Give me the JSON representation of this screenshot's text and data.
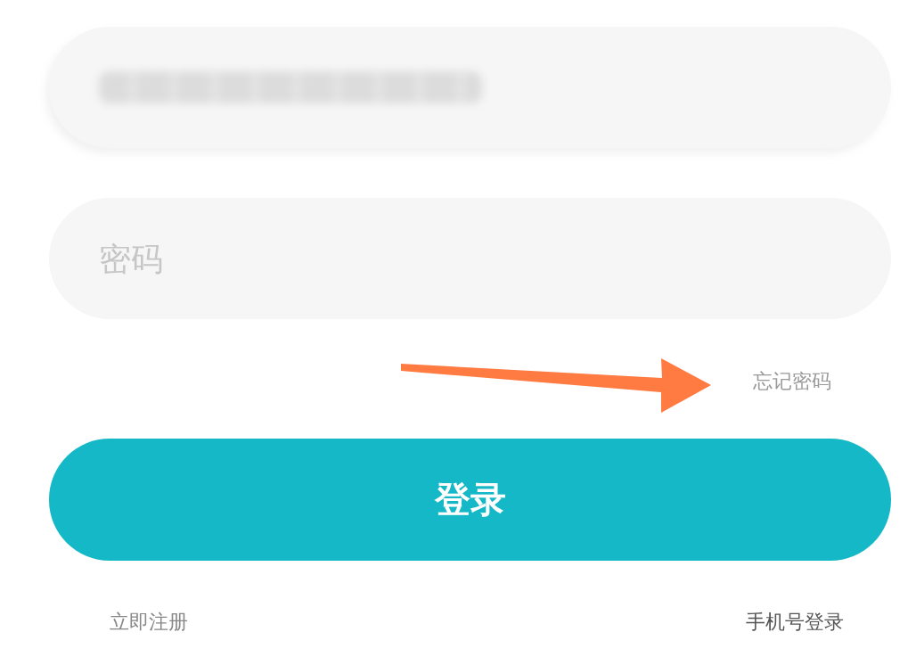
{
  "account_field": {
    "blurred": true
  },
  "password_field": {
    "placeholder": "密码"
  },
  "forgot_password": {
    "label": "忘记密码"
  },
  "login_button": {
    "label": "登录"
  },
  "footer_links": [
    {
      "label": "立即注册"
    },
    {
      "label": "手机号登录"
    }
  ]
}
